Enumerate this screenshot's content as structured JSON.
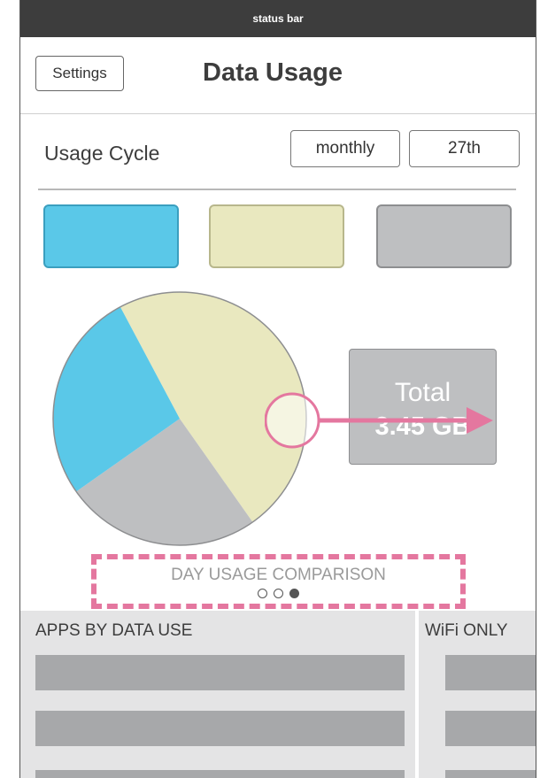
{
  "status_bar": {
    "label": "status bar"
  },
  "header": {
    "settings_label": "Settings",
    "title": "Data Usage"
  },
  "usage_cycle": {
    "label": "Usage Cycle",
    "period_value": "monthly",
    "day_value": "27th"
  },
  "legend": {
    "swatches": [
      {
        "name": "blue",
        "color": "#5ac8e8"
      },
      {
        "name": "yellow",
        "color": "#e9e8bf"
      },
      {
        "name": "gray",
        "color": "#bebfc1"
      }
    ]
  },
  "chart_data": {
    "type": "pie",
    "slices": [
      {
        "label": "",
        "color": "#e9e8bf",
        "value": 48
      },
      {
        "label": "",
        "color": "#bebfc1",
        "value": 25
      },
      {
        "label": "",
        "color": "#5ac8e8",
        "value": 27
      }
    ]
  },
  "total": {
    "label": "Total",
    "value": "3.45 GB"
  },
  "annotation_color": "#e4779f",
  "day_comparison": {
    "label": "DAY USAGE COMPARISON",
    "pages": 3,
    "active_page": 3
  },
  "apps": {
    "title": "APPS BY DATA USE",
    "row_count": 3
  },
  "wifi": {
    "title": "WiFi ONLY",
    "row_count": 3
  }
}
